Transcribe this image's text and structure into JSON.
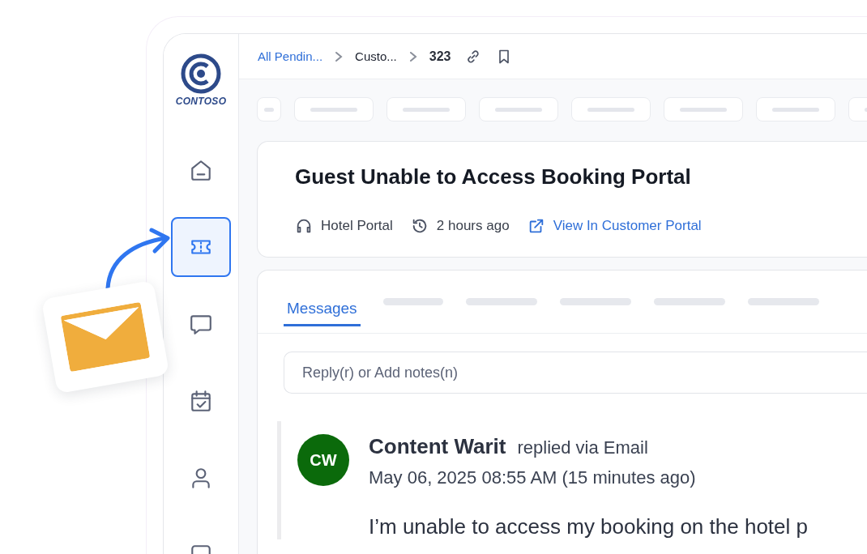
{
  "sidebar": {
    "logo": {
      "text": "CONTOSO"
    },
    "items": [
      {
        "kind": "home",
        "selected": false
      },
      {
        "kind": "ticket",
        "selected": true
      },
      {
        "kind": "chat",
        "selected": false
      },
      {
        "kind": "calendar",
        "selected": false
      },
      {
        "kind": "person",
        "selected": false
      },
      {
        "kind": "square",
        "selected": false
      }
    ]
  },
  "breadcrumbs": [
    {
      "label": "All Pendin...",
      "kind": "link"
    },
    {
      "label": "Custo...",
      "kind": "plain"
    },
    {
      "label": "323",
      "kind": "current"
    }
  ],
  "filter_placeholders": [
    {
      "kind": "small"
    },
    {
      "kind": "wide"
    },
    {
      "kind": "wide"
    },
    {
      "kind": "wide"
    },
    {
      "kind": "wide"
    },
    {
      "kind": "wide"
    },
    {
      "kind": "wide"
    },
    {
      "kind": "wide"
    }
  ],
  "ticket": {
    "title": "Guest Unable to Access Booking Portal",
    "meta": [
      {
        "kind": "channel",
        "text": "Hotel Portal"
      },
      {
        "kind": "time",
        "text": "2 hours ago"
      },
      {
        "kind": "link",
        "text": "View In Customer Portal"
      }
    ]
  },
  "tabs": [
    {
      "label": "Messages",
      "selected": true
    },
    {
      "kind": "placeholder",
      "selected": false
    },
    {
      "kind": "placeholder",
      "selected": false
    },
    {
      "kind": "placeholder",
      "selected": false
    },
    {
      "kind": "placeholder",
      "selected": false
    },
    {
      "kind": "placeholder",
      "selected": false
    }
  ],
  "reply": {
    "placeholder": "Reply(r) or Add notes(n)"
  },
  "message": {
    "initials": "CW",
    "color": "#0b6a0b",
    "author": "Content Warit",
    "via": "replied via Email",
    "date": "May 06, 2025 08:55 AM (15 minutes ago)",
    "body": "I’m unable to access my booking on the hotel p"
  }
}
